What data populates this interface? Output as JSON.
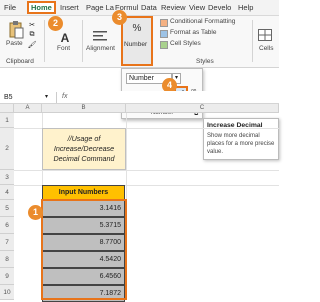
{
  "tabs": [
    "File",
    "Home",
    "Insert",
    "Page La",
    "Formul",
    "Data",
    "Review",
    "View",
    "Develo",
    "Help"
  ],
  "clipboard": {
    "paste": "Paste",
    "group": "Clipboard"
  },
  "font": {
    "label": "Font"
  },
  "alignment": {
    "label": "Alignment"
  },
  "number": {
    "label": "Number",
    "percent": "%"
  },
  "styles": {
    "conditional": "Conditional Formatting",
    "format_table": "Format as Table",
    "cell_styles": "Cell Styles",
    "group": "Styles"
  },
  "cells": {
    "label": "Cells"
  },
  "number_popup": {
    "format": "Number",
    "dollar": "$",
    "percent": "%",
    "comma": "9",
    "dec_inc": ".00 ⇠.0",
    "dec_dec": "←.00 .0",
    "group": "Number"
  },
  "tooltip": {
    "title": "Increase Decimal",
    "body": "Show more decimal places for a more precise value."
  },
  "name_box": "B5",
  "fx": "fx",
  "columns": [
    "A",
    "B",
    "C"
  ],
  "rows": [
    "1",
    "2",
    "3",
    "4",
    "5",
    "6",
    "7",
    "8",
    "9",
    "10"
  ],
  "comment": "//Usage of Increase/Decrease Decimal Command",
  "header": "Input Numbers",
  "values": [
    "3.1416",
    "5.3715",
    "8.7700",
    "4.5420",
    "6.4560",
    "7.1872"
  ],
  "badges": [
    "1",
    "2",
    "3",
    "4"
  ],
  "colors": {
    "accent": "#217346",
    "orange": "#eb8c2d",
    "header_fill": "#ffc000",
    "comment_fill": "#fff2cc"
  }
}
